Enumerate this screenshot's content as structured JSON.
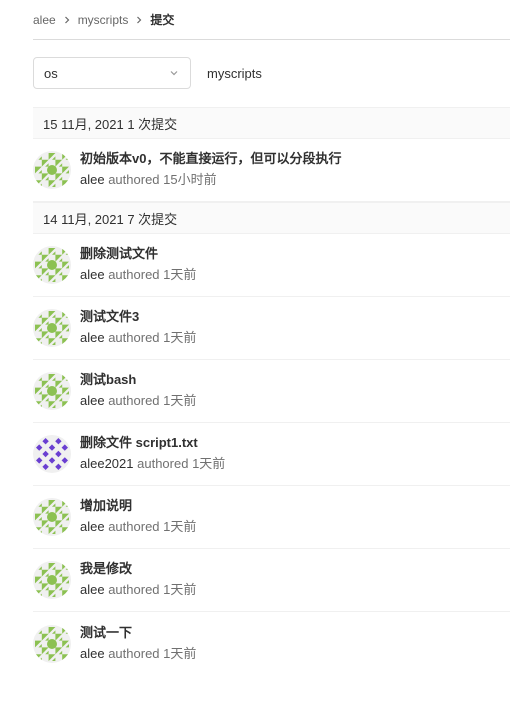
{
  "breadcrumb": {
    "items": [
      "alee",
      "myscripts"
    ],
    "current": "提交"
  },
  "toolbar": {
    "ref_select_value": "os",
    "project_path": "myscripts"
  },
  "commit_groups": [
    {
      "header": "15 11月, 2021 1 次提交",
      "commits": [
        {
          "title": "初始版本v0，不能直接运行，但可以分段执行",
          "author": "alee",
          "authored": "authored",
          "time": "15小时前",
          "avatar": "green-identicon"
        }
      ]
    },
    {
      "header": "14 11月, 2021 7 次提交",
      "commits": [
        {
          "title": "删除测试文件",
          "author": "alee",
          "authored": "authored",
          "time": "1天前",
          "avatar": "green-identicon"
        },
        {
          "title": "测试文件3",
          "author": "alee",
          "authored": "authored",
          "time": "1天前",
          "avatar": "green-identicon"
        },
        {
          "title": "测试bash",
          "author": "alee",
          "authored": "authored",
          "time": "1天前",
          "avatar": "green-identicon"
        },
        {
          "title": "删除文件 script1.txt",
          "author": "alee2021",
          "authored": "authored",
          "time": "1天前",
          "avatar": "purple-identicon"
        },
        {
          "title": "增加说明",
          "author": "alee",
          "authored": "authored",
          "time": "1天前",
          "avatar": "green-identicon"
        },
        {
          "title": "我是修改",
          "author": "alee",
          "authored": "authored",
          "time": "1天前",
          "avatar": "green-identicon"
        },
        {
          "title": "测试一下",
          "author": "alee",
          "authored": "authored",
          "time": "1天前",
          "avatar": "green-identicon"
        }
      ]
    }
  ],
  "colors": {
    "green_identicon": "#8cc152",
    "purple_identicon": "#6a3fd1",
    "identicon_bg": "#f0f0f0"
  },
  "icons": {
    "breadcrumb_separator": "chevron-right-icon",
    "select_caret": "chevron-down-icon"
  }
}
